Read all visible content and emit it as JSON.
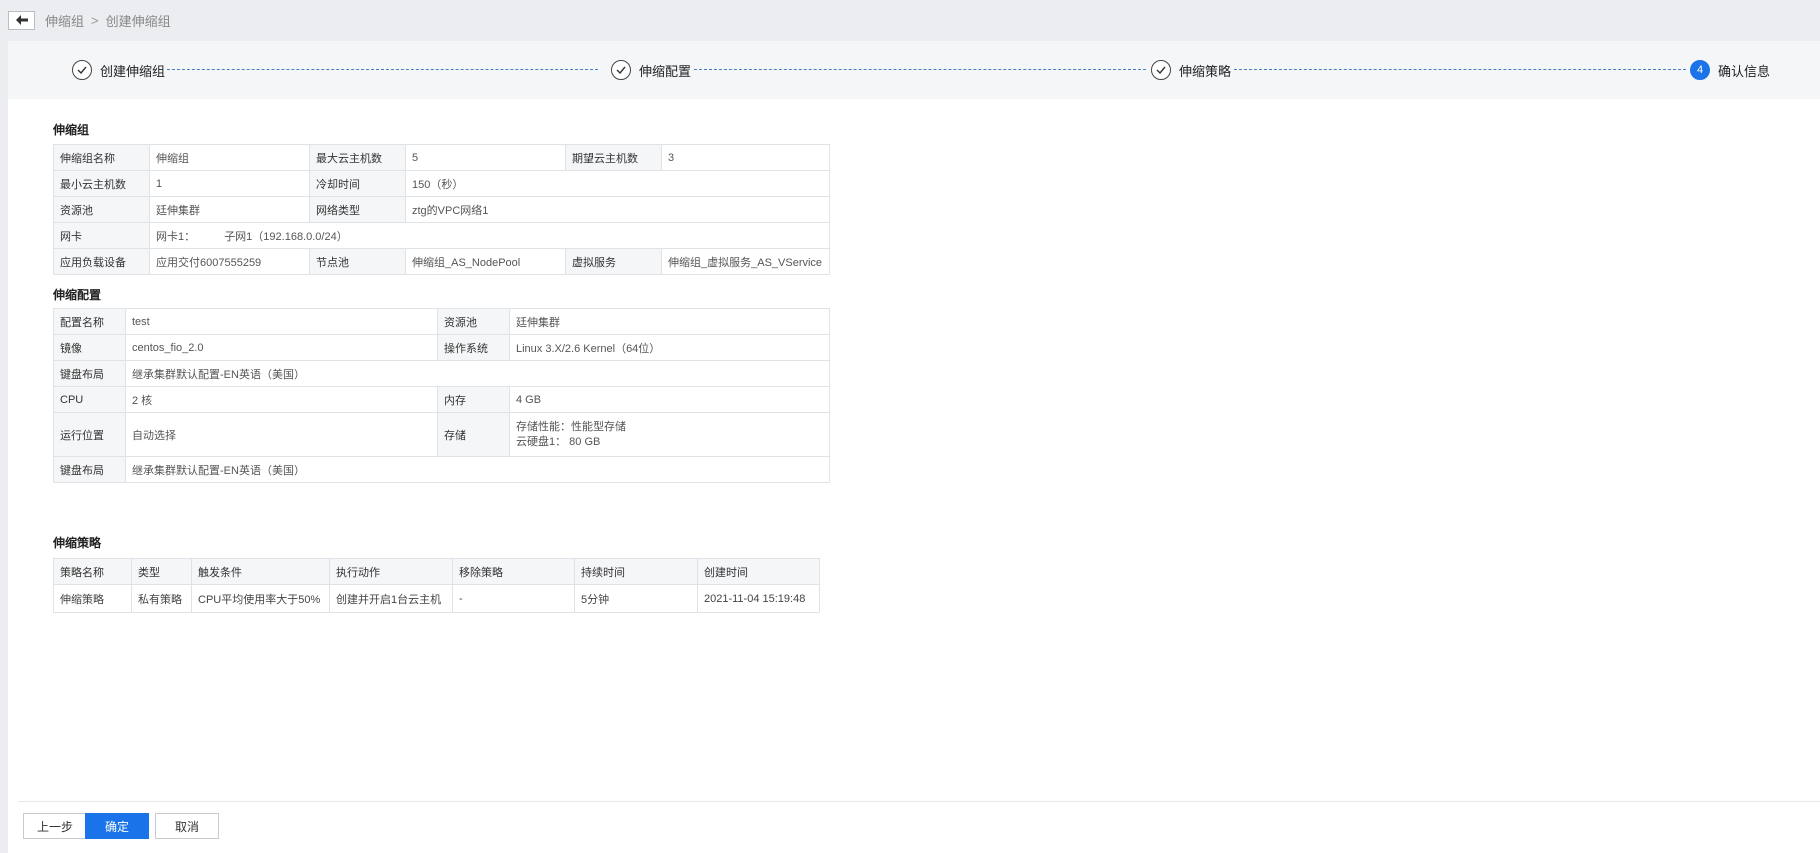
{
  "breadcrumb": {
    "parent": "伸缩组",
    "separator": ">",
    "current": "创建伸缩组"
  },
  "steps": [
    {
      "label": "创建伸缩组",
      "state": "done"
    },
    {
      "label": "伸缩配置",
      "state": "done"
    },
    {
      "label": "伸缩策略",
      "state": "done"
    },
    {
      "label": "确认信息",
      "state": "active",
      "number": "4"
    }
  ],
  "group_section": {
    "title": "伸缩组",
    "name_key": "伸缩组名称",
    "name_val": "伸缩组",
    "max_key": "最大云主机数",
    "max_val": "5",
    "expect_key": "期望云主机数",
    "expect_val": "3",
    "min_key": "最小云主机数",
    "min_val": "1",
    "cooldown_key": "冷却时间",
    "cooldown_val": "150（秒）",
    "pool_key": "资源池",
    "pool_val": "廷伸集群",
    "net_key": "网络类型",
    "net_val": "ztg的VPC网络1",
    "nic_key": "网卡",
    "nic_val": "网卡1：",
    "subnet_val": "子网1（192.168.0.0/24）",
    "lb_key": "应用负载设备",
    "lb_val": "应用交付6007555259",
    "node_key": "节点池",
    "node_val": "伸缩组_AS_NodePool",
    "vs_key": "虚拟服务",
    "vs_val": "伸缩组_虚拟服务_AS_VService"
  },
  "config_section": {
    "title": "伸缩配置",
    "cfg_name_key": "配置名称",
    "cfg_name_val": "test",
    "pool_key": "资源池",
    "pool_val": "廷伸集群",
    "image_key": "镜像",
    "image_val": "centos_fio_2.0",
    "os_key": "操作系统",
    "os_val": "Linux 3.X/2.6 Kernel（64位）",
    "kb_key": "键盘布局",
    "kb_val": "继承集群默认配置-EN英语（美国）",
    "cpu_key": "CPU",
    "cpu_val": "2 核",
    "mem_key": "内存",
    "mem_val": "4 GB",
    "loc_key": "运行位置",
    "loc_val": "自动选择",
    "storage_key": "存储",
    "storage_line1": "存储性能：性能型存储",
    "storage_line2": "云硬盘1：  80 GB",
    "kb2_key": "键盘布局",
    "kb2_val": "继承集群默认配置-EN英语（美国）"
  },
  "policy_section": {
    "title": "伸缩策略",
    "headers": [
      "策略名称",
      "类型",
      "触发条件",
      "执行动作",
      "移除策略",
      "持续时间",
      "创建时间"
    ],
    "rows": [
      [
        "伸缩策略",
        "私有策略",
        "CPU平均使用率大于50%",
        "创建并开启1台云主机",
        "-",
        "5分钟",
        "2021-11-04 15:19:48"
      ]
    ]
  },
  "footer": {
    "prev_label": "上一步",
    "confirm_label": "确定",
    "cancel_label": "取消"
  },
  "colors": {
    "primary": "#1a73e8",
    "step_line": "#4a7dc4"
  }
}
